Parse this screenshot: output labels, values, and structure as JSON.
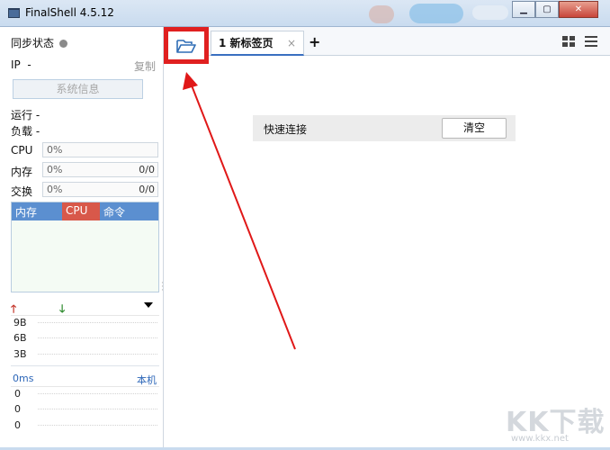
{
  "window": {
    "title": "FinalShell 4.5.12"
  },
  "left_panel": {
    "sync_status_label": "同步状态",
    "ip_label": "IP",
    "ip_value": "-",
    "copy_label": "复制",
    "sysinfo_button": "系统信息",
    "uptime_label": "运行",
    "uptime_value": "-",
    "load_label": "负载",
    "load_value": "-",
    "cpu_label": "CPU",
    "cpu_percent": "0%",
    "mem_label": "内存",
    "mem_percent": "0%",
    "mem_ratio": "0/0",
    "swap_label": "交换",
    "swap_percent": "0%",
    "swap_ratio": "0/0",
    "process_columns": [
      "内存",
      "CPU",
      "命令"
    ],
    "network": {
      "labels": [
        "9B",
        "6B",
        "3B"
      ]
    },
    "ping": {
      "label": "0ms",
      "local_label": "本机",
      "values": [
        "0",
        "0",
        "0"
      ]
    }
  },
  "tabs": [
    {
      "label": "1 新标签页",
      "close": "×"
    }
  ],
  "add_tab": "+",
  "quick_connect": {
    "label": "快速连接",
    "clear_button": "清空"
  },
  "watermark": {
    "text": "KK下载",
    "url": "www.kkx.net"
  }
}
